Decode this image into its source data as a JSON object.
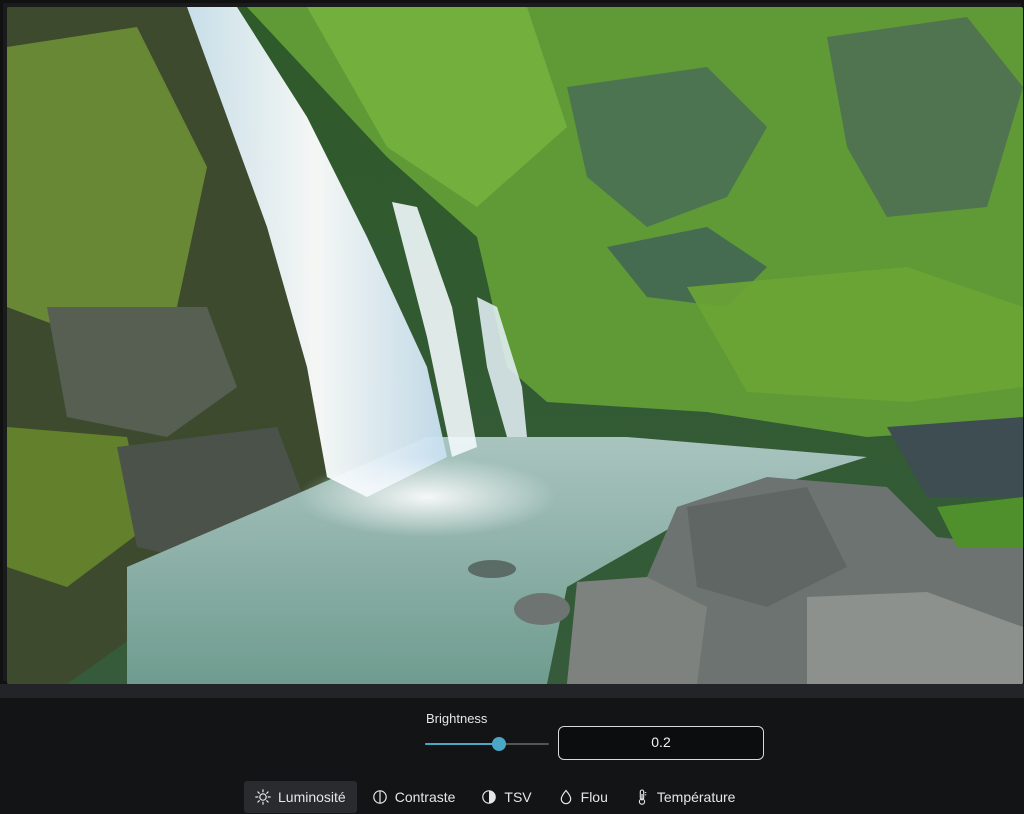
{
  "editor": {
    "image_alt": "Waterfall over mossy cliffs into a turquoise pool with rocks"
  },
  "adjustment": {
    "label": "Brightness",
    "value": "0.2",
    "slider_fraction": 0.6
  },
  "toolbar": {
    "tools": [
      {
        "label": "Luminosité",
        "icon": "sun-icon",
        "active": true
      },
      {
        "label": "Contraste",
        "icon": "contrast-icon",
        "active": false
      },
      {
        "label": "TSV",
        "icon": "half-circle-icon",
        "active": false
      },
      {
        "label": "Flou",
        "icon": "drop-icon",
        "active": false
      },
      {
        "label": "Température",
        "icon": "thermometer-icon",
        "active": false
      }
    ]
  },
  "colors": {
    "accent": "#4aa7c6",
    "background": "#131416"
  }
}
